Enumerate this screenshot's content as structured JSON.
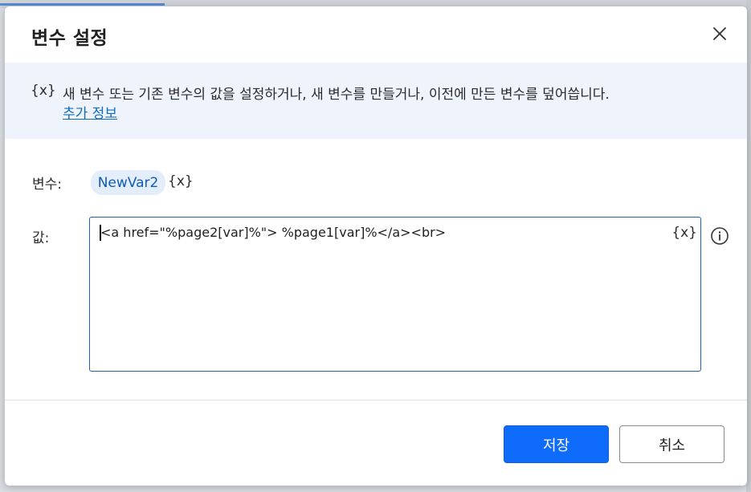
{
  "dialog": {
    "title": "변수 설정",
    "close_icon": "close-icon"
  },
  "info": {
    "icon_text": "{x}",
    "description": "새 변수 또는 기존 변수의 값을 설정하거나, 새 변수를 만들거나, 이전에 만든 변수를 덮어씁니다.",
    "link": "추가 정보"
  },
  "variable": {
    "label": "변수:",
    "name": "NewVar2",
    "picker_icon": "{x}"
  },
  "value": {
    "label": "값:",
    "text": "<a href=\"%page2[var]%\"> %page1[var]%</a><br>",
    "picker_icon": "{x}",
    "help_icon": "info-icon"
  },
  "buttons": {
    "save": "저장",
    "cancel": "취소"
  },
  "colors": {
    "primary": "#0f6cfa",
    "link": "#0f6cbd",
    "banner_bg": "#eff4fc",
    "chip_bg": "#e4eefb"
  }
}
